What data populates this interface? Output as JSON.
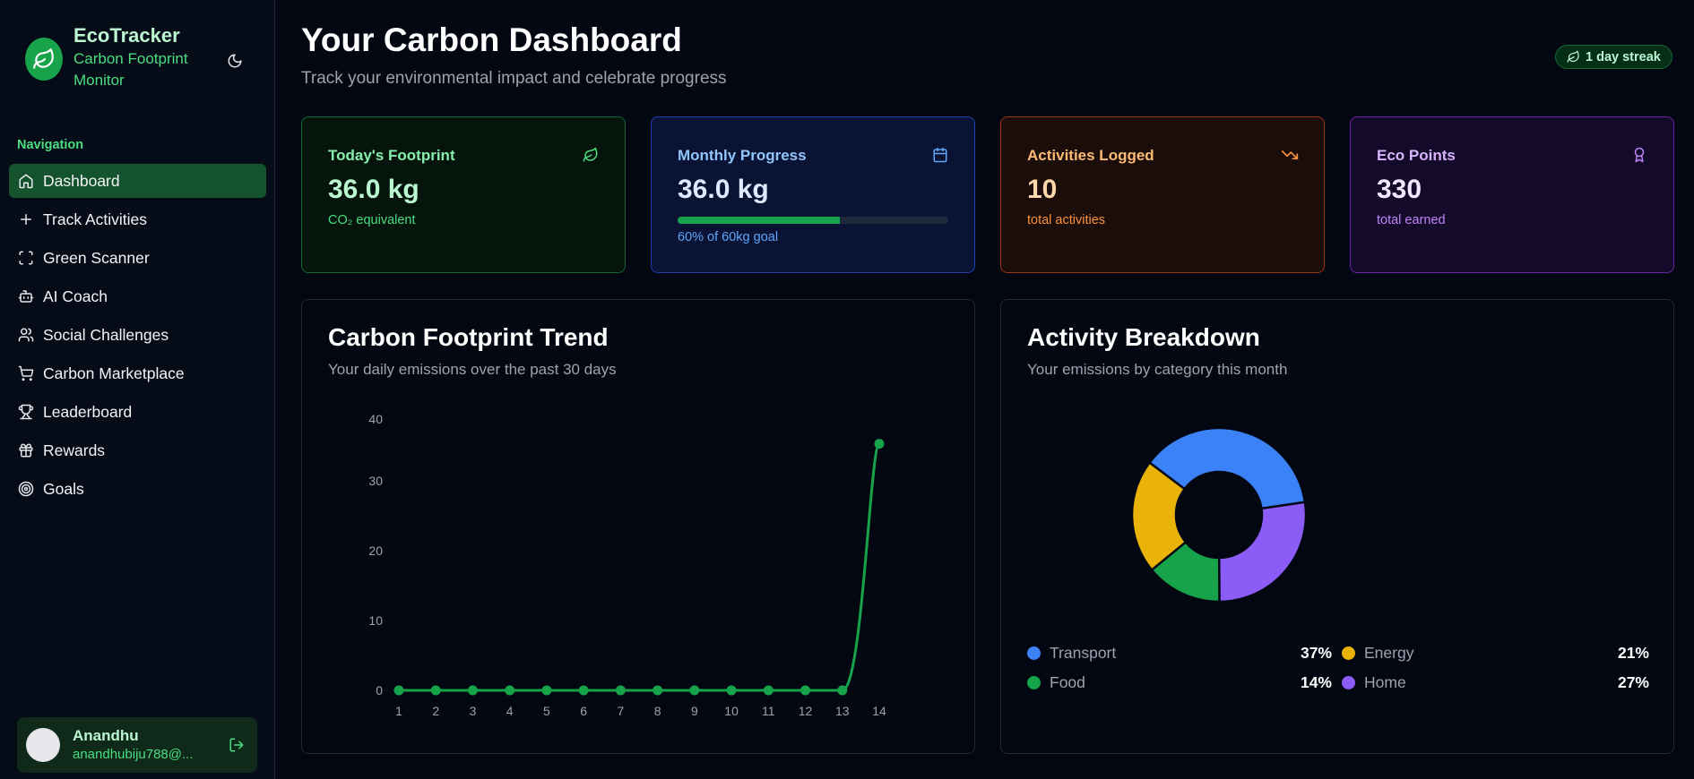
{
  "brand": {
    "title": "EcoTracker",
    "subtitle": "Carbon Footprint Monitor"
  },
  "nav": {
    "heading": "Navigation",
    "items": [
      {
        "label": "Dashboard",
        "icon": "home-icon",
        "active": true
      },
      {
        "label": "Track Activities",
        "icon": "plus-icon"
      },
      {
        "label": "Green Scanner",
        "icon": "scan-icon"
      },
      {
        "label": "AI Coach",
        "icon": "bot-icon"
      },
      {
        "label": "Social Challenges",
        "icon": "users-icon"
      },
      {
        "label": "Carbon Marketplace",
        "icon": "cart-icon"
      },
      {
        "label": "Leaderboard",
        "icon": "trophy-icon"
      },
      {
        "label": "Rewards",
        "icon": "gift-icon"
      },
      {
        "label": "Goals",
        "icon": "target-icon"
      }
    ]
  },
  "user": {
    "name": "Anandhu",
    "email": "anandhubiju788@..."
  },
  "header": {
    "title": "Your Carbon Dashboard",
    "subtitle": "Track your environmental impact and celebrate progress",
    "streak": "1 day streak"
  },
  "stats": {
    "today": {
      "label": "Today's Footprint",
      "value": "36.0 kg",
      "note": "CO₂ equivalent"
    },
    "monthly": {
      "label": "Monthly Progress",
      "value": "36.0 kg",
      "note": "60% of 60kg goal",
      "progress": 0.6
    },
    "activities": {
      "label": "Activities Logged",
      "value": "10",
      "note": "total activities"
    },
    "points": {
      "label": "Eco Points",
      "value": "330",
      "note": "total earned"
    }
  },
  "trend": {
    "title": "Carbon Footprint Trend",
    "subtitle": "Your daily emissions over the past 30 days"
  },
  "breakdown": {
    "title": "Activity Breakdown",
    "subtitle": "Your emissions by category this month"
  },
  "colors": {
    "green": "#16a34a",
    "transport": "#3b82f6",
    "energy": "#eab308",
    "food": "#16a34a",
    "home": "#8b5cf6"
  },
  "chart_data": [
    {
      "type": "line",
      "x": [
        1,
        2,
        3,
        4,
        5,
        6,
        7,
        8,
        9,
        10,
        11,
        12,
        13,
        14
      ],
      "series": [
        {
          "values": [
            0,
            0,
            0,
            0,
            0,
            0,
            0,
            0,
            0,
            0,
            0,
            0,
            0,
            36
          ]
        }
      ],
      "yticks": [
        0,
        10,
        20,
        30,
        40
      ],
      "ylim": [
        0,
        40
      ],
      "grid": false
    },
    {
      "type": "pie",
      "donut": true,
      "categories": [
        "Transport",
        "Home",
        "Food",
        "Energy"
      ],
      "values": [
        37,
        27,
        14,
        21
      ],
      "labels": [
        "37%",
        "27%",
        "14%",
        "21%"
      ]
    }
  ]
}
